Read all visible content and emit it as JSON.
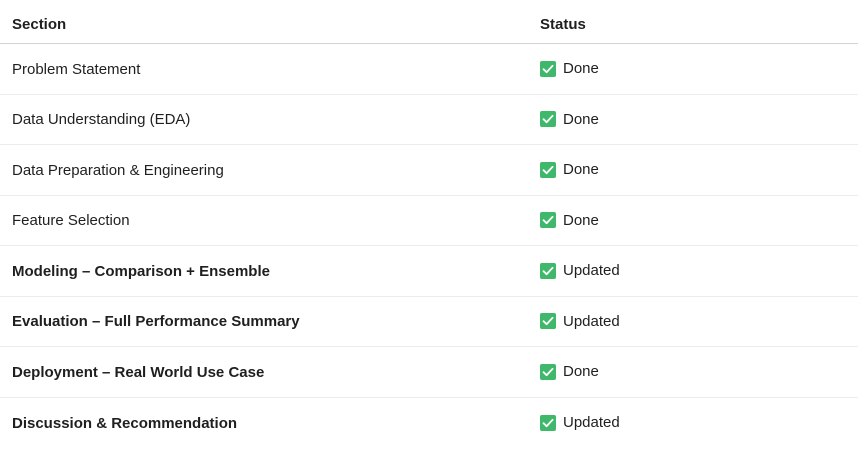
{
  "header": {
    "section_label": "Section",
    "status_label": "Status"
  },
  "rows": [
    {
      "section": "Problem Statement",
      "status": "Done",
      "bold": false,
      "status_icon": "check-mark-icon"
    },
    {
      "section": "Data Understanding (EDA)",
      "status": "Done",
      "bold": false,
      "status_icon": "check-mark-icon"
    },
    {
      "section": "Data Preparation & Engineering",
      "status": "Done",
      "bold": false,
      "status_icon": "check-mark-icon"
    },
    {
      "section": "Feature Selection",
      "status": "Done",
      "bold": false,
      "status_icon": "check-mark-icon"
    },
    {
      "section": "Modeling – Comparison + Ensemble",
      "status": "Updated",
      "bold": true,
      "status_icon": "check-mark-icon"
    },
    {
      "section": "Evaluation – Full Performance Summary",
      "status": "Updated",
      "bold": true,
      "status_icon": "check-mark-icon"
    },
    {
      "section": "Deployment – Real World Use Case",
      "status": "Done",
      "bold": true,
      "status_icon": "check-mark-icon"
    },
    {
      "section": "Discussion & Recommendation",
      "status": "Updated",
      "bold": true,
      "status_icon": "check-mark-icon"
    }
  ],
  "colors": {
    "check_background": "#3fb86b",
    "header_border": "#d4d4d4",
    "row_border": "#ececec"
  }
}
